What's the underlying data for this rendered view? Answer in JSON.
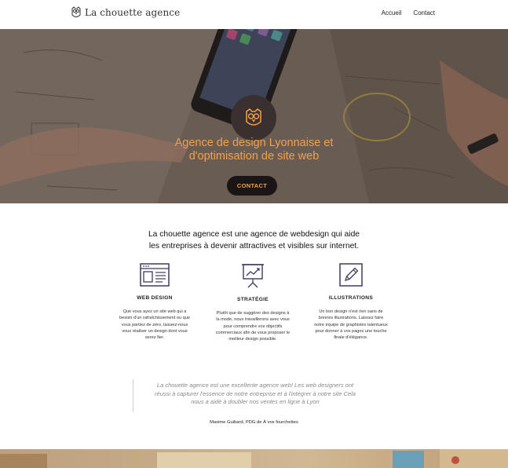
{
  "header": {
    "logo_text": "La chouette agence",
    "nav": [
      {
        "label": "Accueil"
      },
      {
        "label": "Contact"
      }
    ]
  },
  "hero": {
    "title_line1": "Agence de design Lyonnaise et",
    "title_line2": "d'optimisation de site web",
    "cta_label": "CONTACT",
    "accent": "#f4a04c"
  },
  "intro": {
    "line1": "La chouette agence est une agence de webdesign qui aide",
    "line2": "les entreprises à devenir attractives et visibles sur internet."
  },
  "services": [
    {
      "title": "WEB DESIGN",
      "icon": "browser-window-icon",
      "desc_lines": [
        "Que vous ayez un site web qui a",
        "besoin d'un rafraîchissement ou que",
        "vous partiez de zéro, laissez-nous",
        "vous réaliser un design dont vous",
        "serez fier."
      ]
    },
    {
      "title": "STRATÉGIE",
      "icon": "presentation-chart-icon",
      "desc_lines": [
        "Plutôt que de suggérer des designs à",
        "la mode, nous travaillerons avec vous",
        "pour comprendre vos objectifs",
        "commerciaux afin de vous proposer le",
        "meilleur design possible."
      ]
    },
    {
      "title": "ILLUSTRATIONS",
      "icon": "pencil-icon",
      "desc_lines": [
        "Un bon design n'est rien sans de",
        "bonnes illustrations. Laissez faire",
        "notre équipe de graphistes talentueux",
        "pour donner à vos pages une touche",
        "finale d'élégance."
      ]
    }
  ],
  "testimonial": {
    "quote_lines": [
      "La chouette agence est une excellente agence web! Les web designers ont",
      "réussi à capturer l'essence de notre entreprise et à l'intégrer à notre site Cela",
      "nous a aidé à doubler nos ventes en ligne à Lyon"
    ],
    "author": "Maxime Guibard, PDG de À vos fourchettes"
  },
  "colors": {
    "icon_stroke": "#3e3a5e",
    "cta_bg": "#1b1515"
  }
}
